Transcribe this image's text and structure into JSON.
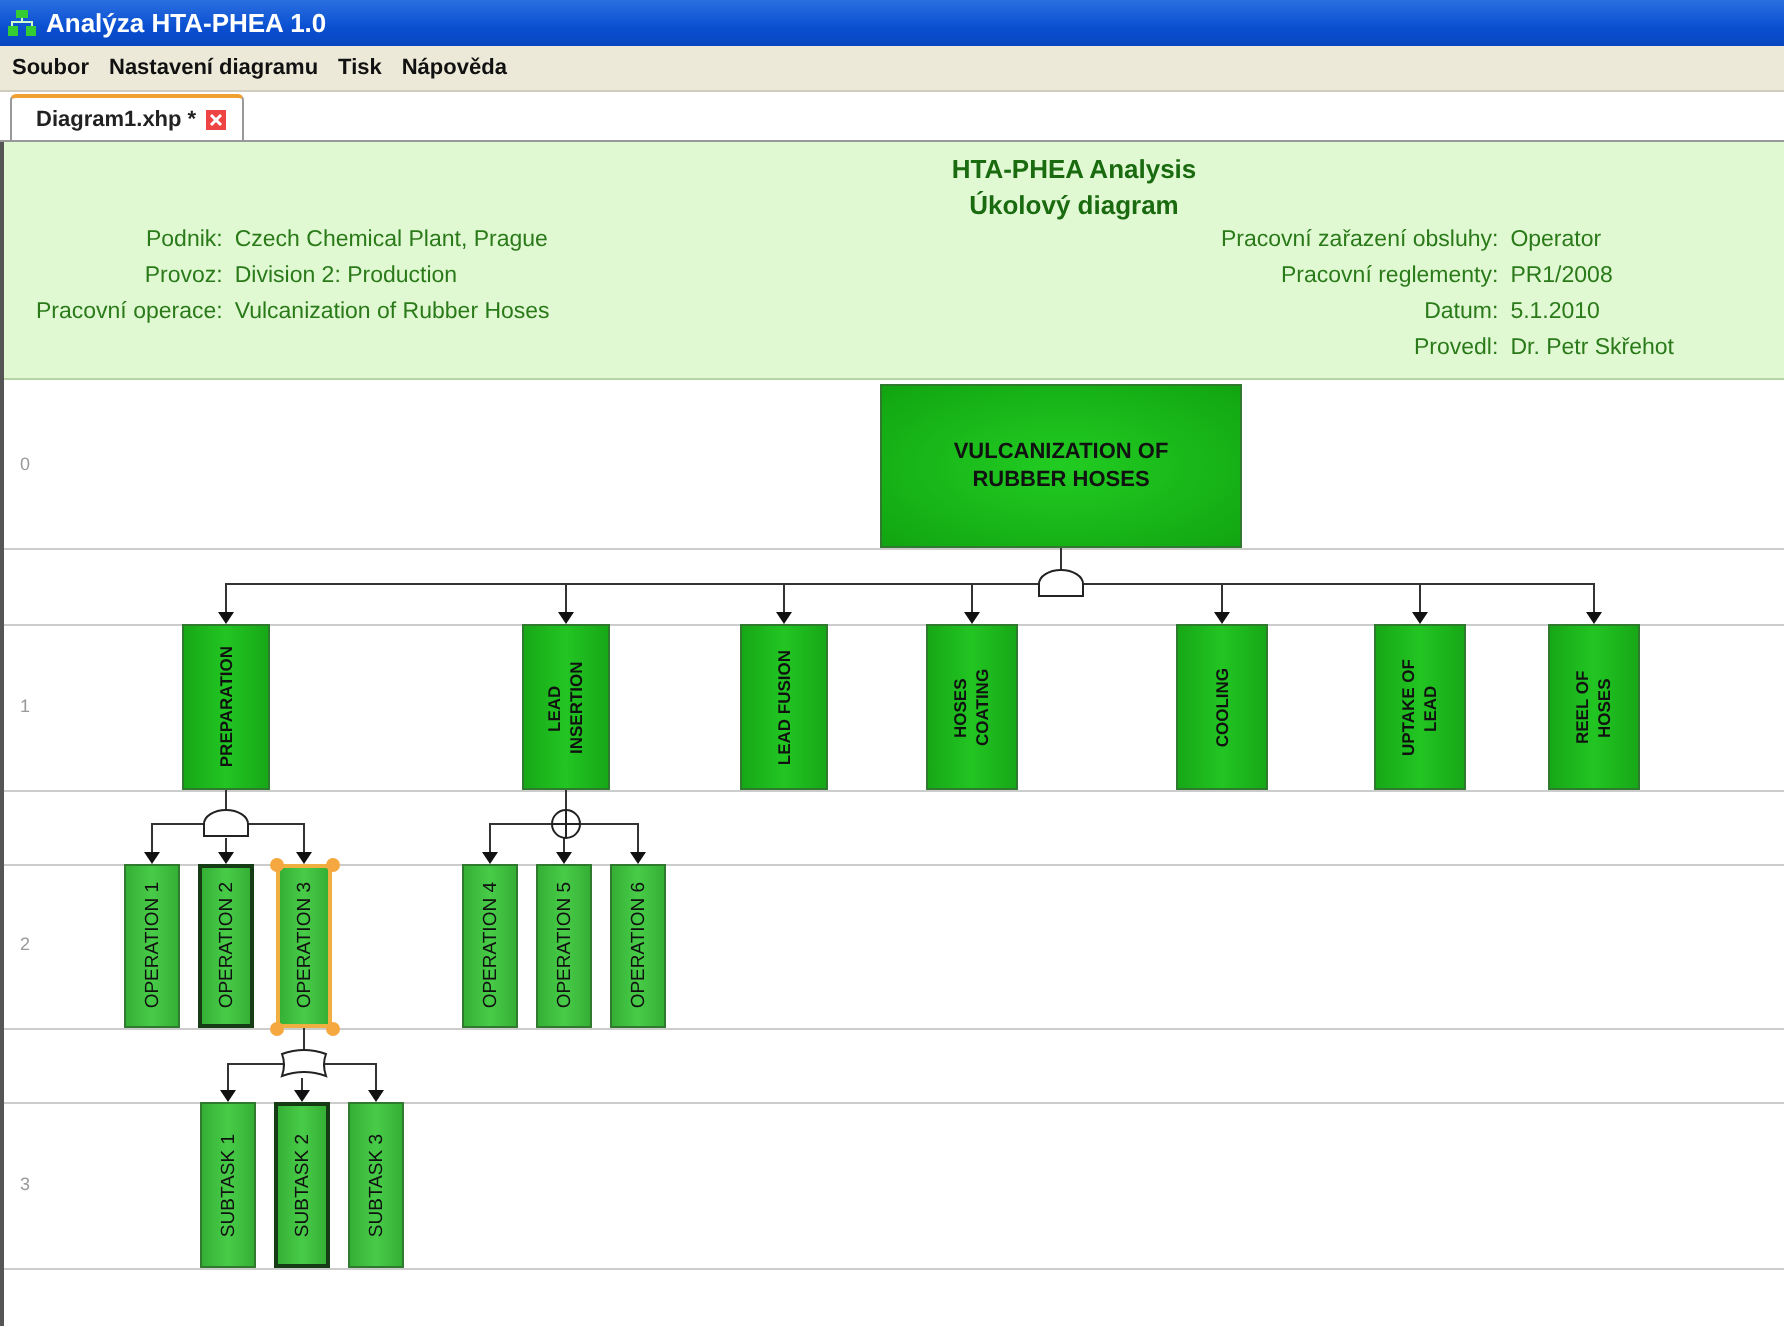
{
  "window": {
    "title": "Analýza HTA-PHEA 1.0"
  },
  "menu": [
    "Soubor",
    "Nastavení diagramu",
    "Tisk",
    "Nápověda"
  ],
  "tabs": [
    {
      "label": "Diagram1.xhp *",
      "selected": true
    }
  ],
  "header": {
    "title": "HTA-PHEA Analysis",
    "subtitle": "Úkolový diagram",
    "left": [
      {
        "label": "Podnik:",
        "value": "Czech Chemical Plant, Prague"
      },
      {
        "label": "Provoz:",
        "value": "Division 2: Production"
      },
      {
        "label": "Pracovní operace:",
        "value": "Vulcanization of Rubber Hoses"
      }
    ],
    "right": [
      {
        "label": "Pracovní zařazení obsluhy:",
        "value": "Operator"
      },
      {
        "label": "Pracovní reglementy:",
        "value": "PR1/2008"
      },
      {
        "label": "Datum:",
        "value": "5.1.2010"
      },
      {
        "label": "Provedl:",
        "value": "Dr. Petr Skřehot"
      }
    ]
  },
  "diagram": {
    "levels": [
      "0",
      "1",
      "2",
      "3"
    ],
    "root": {
      "label": "VULCANIZATION OF RUBBER HOSES",
      "selected": false,
      "outlined": false,
      "gate": {
        "kind": "and"
      },
      "children": [
        {
          "label": "PREPARATION",
          "selected": false,
          "outlined": false,
          "gate": {
            "kind": "and"
          },
          "children": [
            {
              "label": "OPERATION 1",
              "selected": false,
              "outlined": false
            },
            {
              "label": "OPERATION 2",
              "selected": false,
              "outlined": true
            },
            {
              "label": "OPERATION 3",
              "selected": true,
              "outlined": false,
              "gate": {
                "kind": "or"
              },
              "children": [
                {
                  "label": "SUBTASK 1",
                  "selected": false,
                  "outlined": false
                },
                {
                  "label": "SUBTASK 2",
                  "selected": false,
                  "outlined": true
                },
                {
                  "label": "SUBTASK 3",
                  "selected": false,
                  "outlined": false
                }
              ]
            }
          ]
        },
        {
          "label": "LEAD INSERTION",
          "selected": false,
          "outlined": false,
          "gate": {
            "kind": "xor"
          },
          "children": [
            {
              "label": "OPERATION 4",
              "selected": false,
              "outlined": false
            },
            {
              "label": "OPERATION 5",
              "selected": false,
              "outlined": false
            },
            {
              "label": "OPERATION 6",
              "selected": false,
              "outlined": false
            }
          ]
        },
        {
          "label": "LEAD FUSION",
          "selected": false,
          "outlined": false
        },
        {
          "label": "HOSES COATING",
          "selected": false,
          "outlined": false
        },
        {
          "label": "COOLING",
          "selected": false,
          "outlined": false
        },
        {
          "label": "UPTAKE OF LEAD",
          "selected": false,
          "outlined": false
        },
        {
          "label": "REEL OF HOSES",
          "selected": false,
          "outlined": false
        }
      ]
    }
  }
}
